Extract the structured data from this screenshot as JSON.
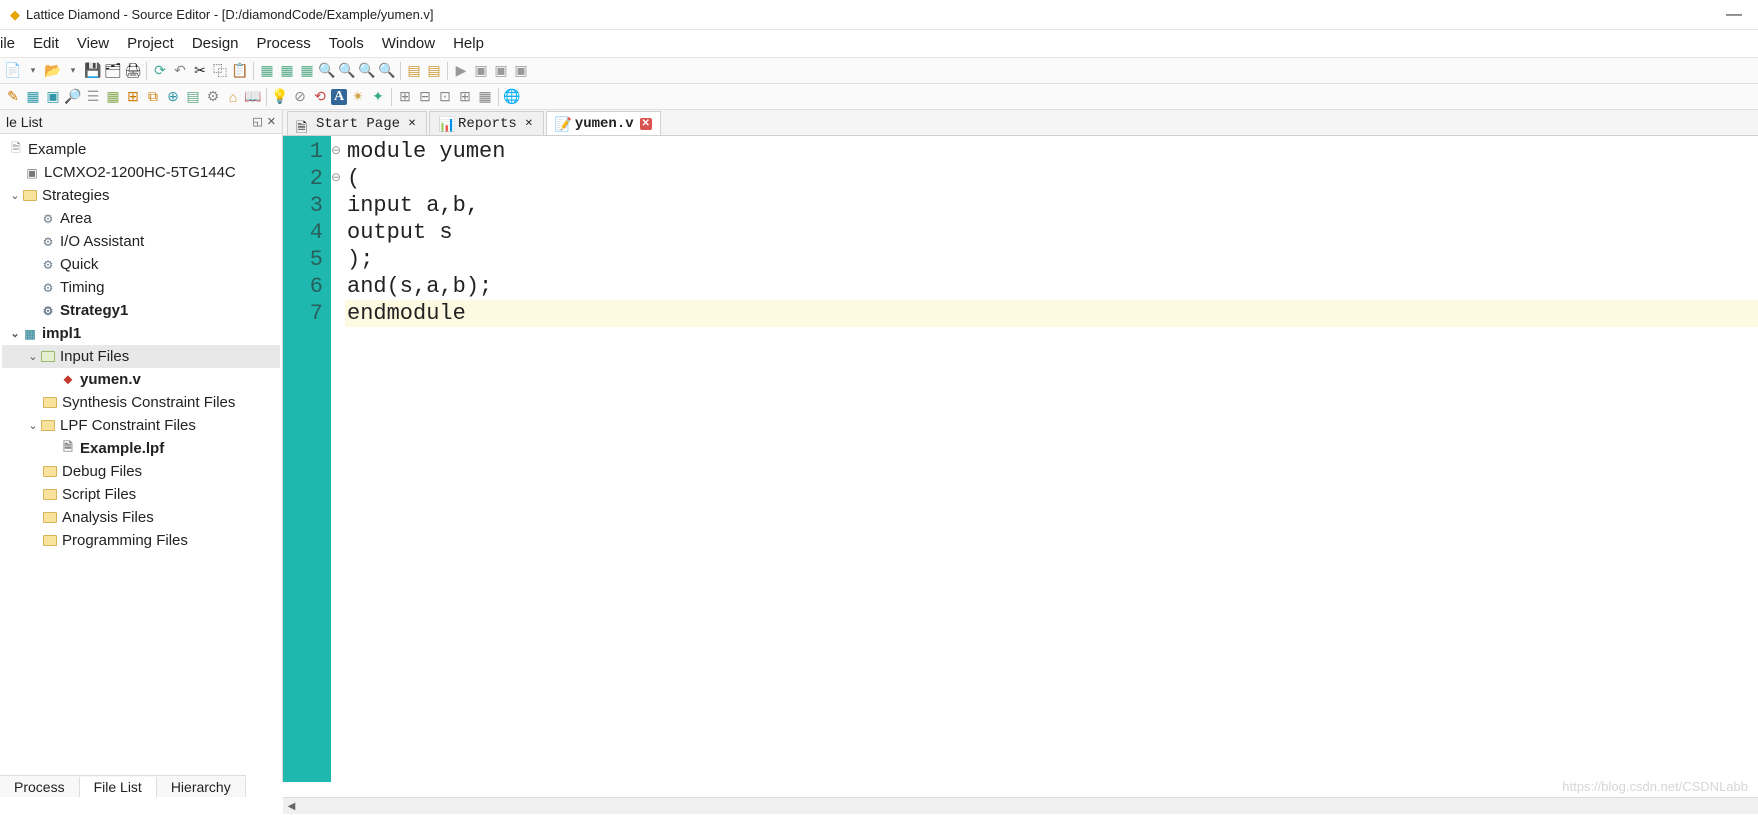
{
  "title": "Lattice Diamond - Source Editor - [D:/diamondCode/Example/yumen.v]",
  "menu": [
    "ile",
    "Edit",
    "View",
    "Project",
    "Design",
    "Process",
    "Tools",
    "Window",
    "Help"
  ],
  "sidebar": {
    "title": "le List",
    "tree": {
      "project": "Example",
      "device": "LCMXO2-1200HC-5TG144C",
      "strategies_label": "Strategies",
      "strategies": [
        "Area",
        "I/O Assistant",
        "Quick",
        "Timing",
        "Strategy1"
      ],
      "impl": "impl1",
      "input_files_label": "Input Files",
      "input_file": "yumen.v",
      "synth_label": "Synthesis Constraint Files",
      "lpf_label": "LPF Constraint Files",
      "lpf_file": "Example.lpf",
      "debug_label": "Debug Files",
      "script_label": "Script Files",
      "analysis_label": "Analysis Files",
      "prog_label": "Programming Files"
    }
  },
  "tabs": [
    {
      "label": "Start Page",
      "modified": false
    },
    {
      "label": "Reports",
      "modified": false
    },
    {
      "label": "yumen.v",
      "modified": true
    }
  ],
  "code": {
    "lines": [
      "module yumen",
      "(",
      "input a,b,",
      "output s",
      ");",
      "and(s,a,b);",
      "endmodule"
    ],
    "highlight_line": 7
  },
  "bottom_tabs": [
    "Process",
    "File List",
    "Hierarchy"
  ],
  "watermark": "https://blog.csdn.net/CSDNLabb"
}
